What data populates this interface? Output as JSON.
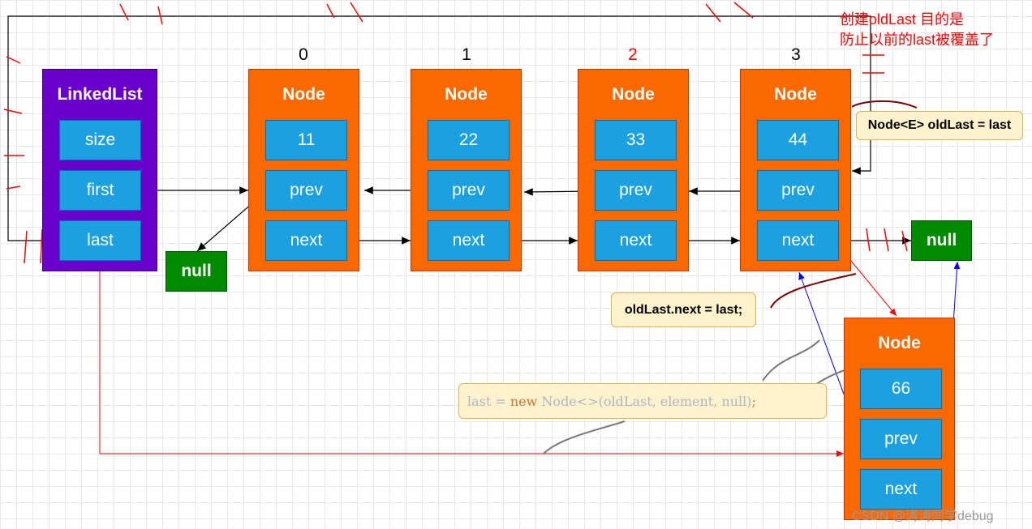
{
  "linked_list": {
    "title": "LinkedList",
    "fields": [
      "size",
      "first",
      "last"
    ]
  },
  "indices": [
    "0",
    "1",
    "2",
    "3"
  ],
  "node_title": "Node",
  "nodes": [
    {
      "value": "11",
      "prev": "prev",
      "next": "next"
    },
    {
      "value": "22",
      "prev": "prev",
      "next": "next"
    },
    {
      "value": "33",
      "prev": "prev",
      "next": "next"
    },
    {
      "value": "44",
      "prev": "prev",
      "next": "next"
    }
  ],
  "new_node": {
    "title": "Node",
    "value": "66",
    "prev": "prev",
    "next": "next"
  },
  "null_label": "null",
  "notes": {
    "old_last_decl": "Node<E> oldLast = last",
    "old_last_next": "oldLast.next = last;",
    "code_lhs": "last = ",
    "code_kw": "new",
    "code_rhs": " Node<>(oldLast, element, null)",
    "code_semi": ";",
    "red_annotation_line1": "创建oldLast 目的是",
    "red_annotation_line2": "防止以前的last被覆盖了"
  },
  "watermark": "CSDN @涛涛同学debug",
  "colors": {
    "linked_list": "#6a00cc",
    "node": "#fa6800",
    "field": "#1ba1e2",
    "null": "#008a00",
    "note": "#fff2cc",
    "index_highlight": "#ff0000"
  }
}
